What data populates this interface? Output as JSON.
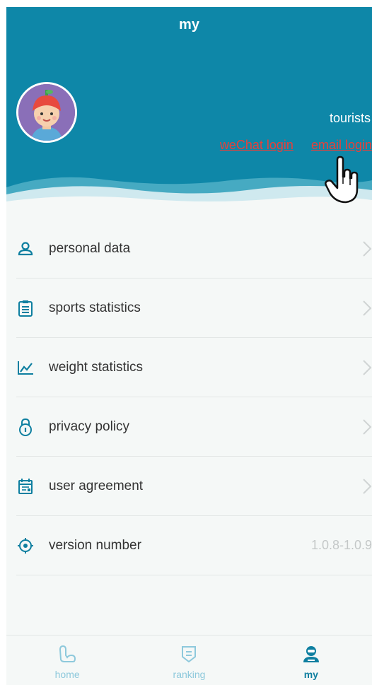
{
  "header": {
    "title": "my"
  },
  "profile": {
    "username": "tourists",
    "wechat_login": "weChat login",
    "email_login": "email login"
  },
  "menu": {
    "items": [
      {
        "label": "personal data",
        "icon": "person-icon"
      },
      {
        "label": "sports statistics",
        "icon": "clipboard-icon"
      },
      {
        "label": "weight statistics",
        "icon": "line-chart-icon"
      },
      {
        "label": "privacy policy",
        "icon": "lock-icon"
      },
      {
        "label": "user agreement",
        "icon": "calendar-icon"
      },
      {
        "label": "version number",
        "icon": "target-icon"
      }
    ],
    "version_value": "1.0.8-1.0.9"
  },
  "tabbar": {
    "tabs": [
      {
        "label": "home",
        "icon": "arm-icon",
        "active": false
      },
      {
        "label": "ranking",
        "icon": "ranking-icon",
        "active": false
      },
      {
        "label": "my",
        "icon": "user-icon",
        "active": true
      }
    ]
  },
  "colors": {
    "header": "#0e87a8",
    "accent": "#0e7fa0",
    "link": "#e8403a",
    "tab_inactive": "#8ec9dc"
  }
}
